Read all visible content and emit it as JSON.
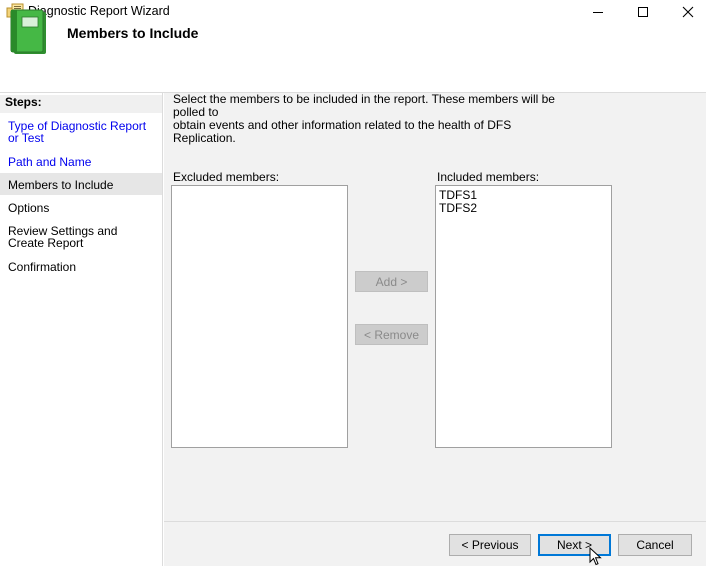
{
  "window": {
    "title": "Diagnostic Report Wizard",
    "minimize": "—",
    "maximize": "☐",
    "close": "✕"
  },
  "header": {
    "title": "Members to Include"
  },
  "steps": {
    "label": "Steps:",
    "items": [
      {
        "label": "Type of Diagnostic Report or Test",
        "state": "link"
      },
      {
        "label": "Path and Name",
        "state": "link"
      },
      {
        "label": "Members to Include",
        "state": "current"
      },
      {
        "label": "Options",
        "state": "plain"
      },
      {
        "label": "Review Settings and Create Report",
        "state": "plain"
      },
      {
        "label": "Confirmation",
        "state": "plain"
      }
    ]
  },
  "main": {
    "instruction_line1": "Select the members to be included in the report. These members will be polled to",
    "instruction_line2": "obtain events and other information related to the health of DFS Replication.",
    "excluded_label": "Excluded members:",
    "excluded_items": [],
    "included_label": "Included members:",
    "included_items": [
      "TDFS1",
      "TDFS2"
    ],
    "add_button": "Add >",
    "remove_button": "< Remove"
  },
  "footer": {
    "previous_button": "< Previous",
    "next_button": "Next >",
    "cancel_button": "Cancel"
  },
  "colors": {
    "link": "#0000ee",
    "accent": "#0078d7",
    "icon_green": "#3aa53a"
  }
}
